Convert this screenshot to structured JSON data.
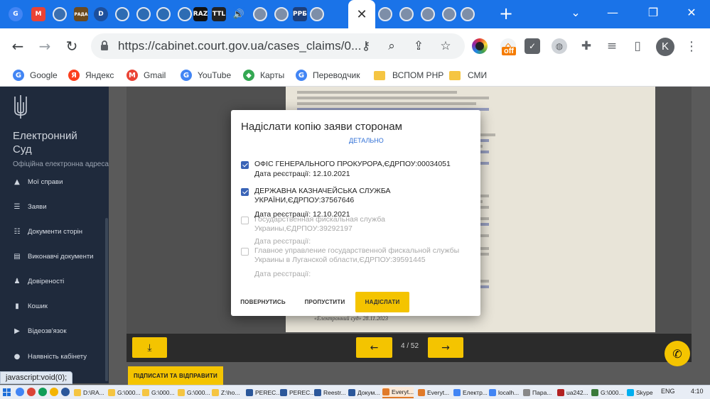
{
  "browser": {
    "tabs": [
      {
        "kind": "google",
        "letter": "G",
        "color": "#4285f4"
      },
      {
        "kind": "gmail",
        "letter": "M",
        "color": "#ea4335"
      },
      {
        "kind": "seal",
        "letter": "",
        "color": "#3a6fb0"
      },
      {
        "kind": "rada",
        "letter": "РАДА",
        "color": "#6b4a1e"
      },
      {
        "kind": "d",
        "letter": "D",
        "color": "#1d4f9c"
      },
      {
        "kind": "seal",
        "letter": "",
        "color": "#2d6cb3"
      },
      {
        "kind": "seal",
        "letter": "",
        "color": "#2d6cb3"
      },
      {
        "kind": "seal",
        "letter": "",
        "color": "#2d6cb3"
      },
      {
        "kind": "seal",
        "letter": "",
        "color": "#2d6cb3"
      },
      {
        "kind": "raz",
        "letter": "RAZ",
        "color": "#111111"
      },
      {
        "kind": "ttl",
        "letter": "TTL",
        "color": "#222222"
      },
      {
        "kind": "audio",
        "letter": "🔊",
        "color": "#1a73e8"
      },
      {
        "kind": "seal",
        "letter": "",
        "color": "#7d8ea8"
      },
      {
        "kind": "seal",
        "letter": "",
        "color": "#7d8ea8"
      },
      {
        "kind": "prb",
        "letter": "РРБ",
        "color": "#1d3f7a"
      },
      {
        "kind": "seal",
        "letter": "",
        "color": "#7d8ea8"
      },
      {
        "kind": "active",
        "letter": "✕",
        "color": "#ffffff"
      },
      {
        "kind": "seal",
        "letter": "",
        "color": "#7d8ea8"
      },
      {
        "kind": "seal",
        "letter": "",
        "color": "#7d8ea8"
      },
      {
        "kind": "seal",
        "letter": "",
        "color": "#7d8ea8"
      },
      {
        "kind": "seal",
        "letter": "",
        "color": "#7d8ea8"
      },
      {
        "kind": "seal",
        "letter": "",
        "color": "#7d8ea8"
      }
    ],
    "new_tab": "+",
    "window_controls": {
      "dropdown": "⌄",
      "minimize": "—",
      "restore": "❐",
      "close": "✕"
    },
    "nav": {
      "back": "←",
      "forward": "→",
      "reload": "↻"
    },
    "url": "https://cabinet.court.gov.ua/cases_claims/0...",
    "omnibox_icons": {
      "key": "⚷",
      "zoom": "⌕",
      "share": "⇪",
      "star": "☆"
    },
    "extensions": {
      "off_badge": "off",
      "puzzle": "✚",
      "media": "≡",
      "sidebar": "▯",
      "menu": "⋮"
    },
    "profile_letter": "K",
    "bookmarks": [
      {
        "label": "Google",
        "icon": "G",
        "color": "#4285f4"
      },
      {
        "label": "Яндекс",
        "icon": "Я",
        "color": "#fc3f1d"
      },
      {
        "label": "Gmail",
        "icon": "M",
        "color": "#ea4335"
      },
      {
        "label": "YouTube",
        "icon": "G",
        "color": "#4285f4"
      },
      {
        "label": "Карты",
        "icon": "◆",
        "color": "#34a853"
      },
      {
        "label": "Переводчик",
        "icon": "G",
        "color": "#4285f4"
      },
      {
        "label": "ВСПОМ РНР",
        "icon": "folder",
        "color": "#f5c542"
      },
      {
        "label": "СМИ",
        "icon": "folder",
        "color": "#f5c542"
      }
    ]
  },
  "site": {
    "title_line1": "Електронний",
    "title_line2": "Суд",
    "subtitle": "Офіційна електронна адреса",
    "menu": [
      {
        "label": "Мої справи",
        "icon": "▲"
      },
      {
        "label": "Заяви",
        "icon": "☰"
      },
      {
        "label": "Документи сторін",
        "icon": "☷"
      },
      {
        "label": "Виконавчі документи",
        "icon": "▤"
      },
      {
        "label": "Довіреності",
        "icon": "♟"
      },
      {
        "label": "Кошик",
        "icon": "▮"
      },
      {
        "label": "Відеозв'язок",
        "icon": "▶"
      },
      {
        "label": "Наявність кабінету",
        "icon": "●"
      }
    ]
  },
  "viewer": {
    "doc_footer": "«Електронний суд» 28.11.2023",
    "page_label": "4 / 52",
    "download_icon": "⤓",
    "prev_icon": "←",
    "next_icon": "→",
    "call_icon": "✆",
    "sign_label": "ПІДПИСАТИ ТА ВІДПРАВИТИ"
  },
  "status_link": "javascript:void(0);",
  "modal": {
    "title": "Надіслати копію заяви сторонам",
    "details_link": "ДЕТАЛЬНО",
    "parties": [
      {
        "checked": true,
        "enabled": true,
        "name": "ОФІС ГЕНЕРАЛЬНОГО ПРОКУРОРА,ЄДРПОУ:00034051",
        "date": "Дата реєстрації: 12.10.2021"
      },
      {
        "checked": true,
        "enabled": true,
        "name": "ДЕРЖАВНА КАЗНАЧЕЙСЬКА СЛУЖБА УКРАЇНИ,ЄДРПОУ:37567646",
        "date": "Дата реєстрації: 12.10.2021"
      },
      {
        "checked": false,
        "enabled": false,
        "name": "Государственная фискальная служба Украины,ЄДРПОУ:39292197",
        "date": "Дата реєстрації:"
      },
      {
        "checked": false,
        "enabled": false,
        "name": "Главное управление государственной фискальной службы Украины в Луганской области,ЄДРПОУ:39591445",
        "date": "Дата реєстрації:"
      }
    ],
    "buttons": {
      "back": "ПОВЕРНУТИСЬ",
      "skip": "ПРОПУСТИТИ",
      "send": "НАДІСЛАТИ"
    }
  },
  "taskbar": {
    "items": [
      {
        "label": "D:\\RA...",
        "color": "#f5c542"
      },
      {
        "label": "G:\\000...",
        "color": "#f5c542"
      },
      {
        "label": "G:\\000...",
        "color": "#f5c542"
      },
      {
        "label": "G:\\000...",
        "color": "#f5c542"
      },
      {
        "label": "Z:\\ho...",
        "color": "#f5c542"
      },
      {
        "label": "PEREC...",
        "color": "#2b579a"
      },
      {
        "label": "PEREC...",
        "color": "#2b579a"
      },
      {
        "label": "Reestr...",
        "color": "#2b579a"
      },
      {
        "label": "Докум...",
        "color": "#2b579a"
      },
      {
        "label": "Everyt...",
        "color": "#e07a2a"
      },
      {
        "label": "Everyt...",
        "color": "#e07a2a"
      },
      {
        "label": "Електр...",
        "color": "#4285f4"
      },
      {
        "label": "localh...",
        "color": "#4285f4"
      },
      {
        "label": "Пара...",
        "color": "#888888"
      },
      {
        "label": "ua242...",
        "color": "#b22222"
      },
      {
        "label": "G:\\000...",
        "color": "#3a7a3a"
      },
      {
        "label": "Skype",
        "color": "#00aff0"
      }
    ],
    "active_index": 9,
    "tray_lang": "ENG",
    "tray_time": "4:10"
  }
}
